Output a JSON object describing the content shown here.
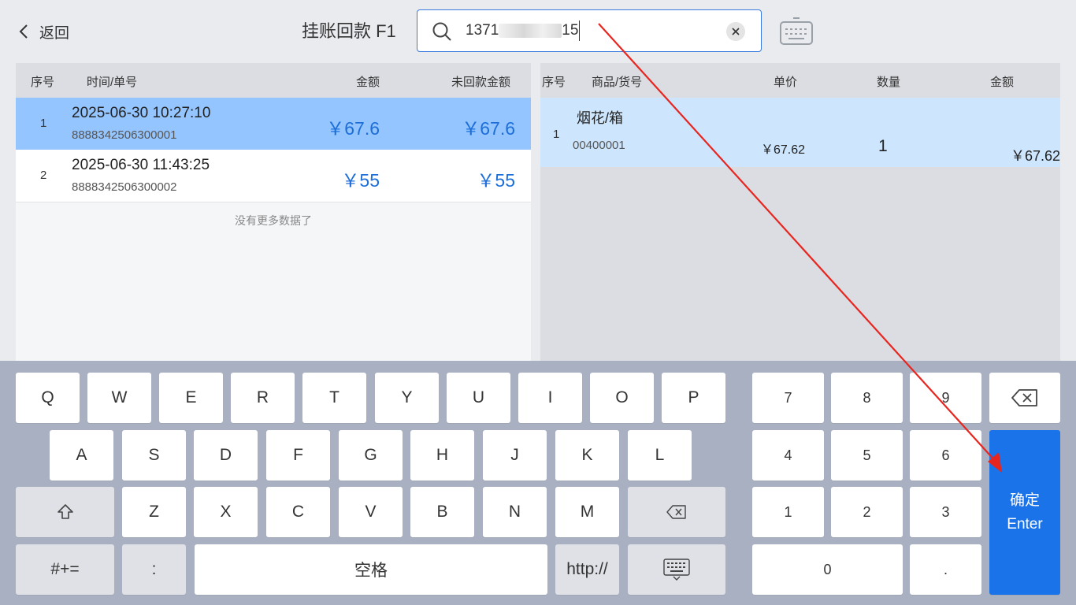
{
  "header": {
    "back_label": "返回",
    "title": "挂账回款 F1",
    "search_value": "1371",
    "search_value_tail": "15"
  },
  "left_table": {
    "columns": [
      "序号",
      "时间/单号",
      "金额",
      "未回款金额"
    ],
    "rows": [
      {
        "idx": "1",
        "time": "2025-06-30 10:27:10",
        "no": "8888342506300001",
        "amount": "￥67.6",
        "unpaid": "￥67.6"
      },
      {
        "idx": "2",
        "time": "2025-06-30 11:43:25",
        "no": "8888342506300002",
        "amount": "￥55",
        "unpaid": "￥55"
      }
    ],
    "no_more": "没有更多数据了"
  },
  "right_table": {
    "columns": [
      "序号",
      "商品/货号",
      "单价",
      "数量",
      "金额"
    ],
    "rows": [
      {
        "idx": "1",
        "name": "烟花/箱",
        "code": "00400001",
        "price": "￥67.62",
        "qty": "1",
        "total": "￥67.62"
      }
    ]
  },
  "keyboard": {
    "row1": [
      "Q",
      "W",
      "E",
      "R",
      "T",
      "Y",
      "U",
      "I",
      "O",
      "P"
    ],
    "row2": [
      "A",
      "S",
      "D",
      "F",
      "G",
      "H",
      "J",
      "K",
      "L"
    ],
    "row3": [
      "Z",
      "X",
      "C",
      "V",
      "B",
      "N",
      "M"
    ],
    "symbols_label": "#+=",
    "colon_label": ":",
    "space_label": "空格",
    "http_label": "http://",
    "numpad": [
      "7",
      "8",
      "9",
      "4",
      "5",
      "6",
      "1",
      "2",
      "3"
    ],
    "zero_label": "0",
    "dot_label": ".",
    "enter_label_cn": "确定",
    "enter_label_en": "Enter"
  },
  "colors": {
    "selected_row": "#94c5ff",
    "amount_text": "#1d6ed8",
    "enter_key": "#1a73e8",
    "keyboard_bg": "#a8b0c1",
    "annotation_arrow": "#e8251f"
  },
  "icons": [
    "chevron-left-icon",
    "search-icon",
    "clear-icon",
    "keyboard-toggle-icon",
    "backspace-icon",
    "shift-icon",
    "keyboard-hide-icon"
  ]
}
